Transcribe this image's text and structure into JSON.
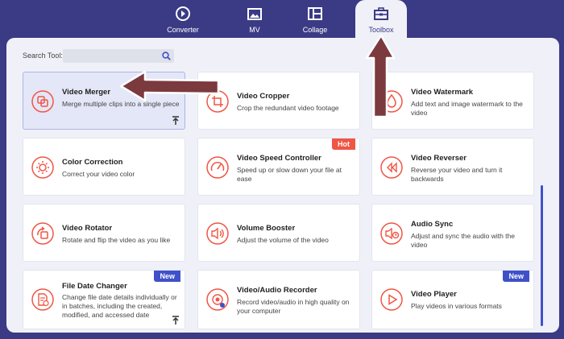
{
  "tabs": [
    {
      "id": "converter",
      "label": "Converter",
      "icon": "converter-icon",
      "active": false
    },
    {
      "id": "mv",
      "label": "MV",
      "icon": "mv-icon",
      "active": false
    },
    {
      "id": "collage",
      "label": "Collage",
      "icon": "collage-icon",
      "active": false
    },
    {
      "id": "toolbox",
      "label": "Toolbox",
      "icon": "toolbox-icon",
      "active": true
    }
  ],
  "search": {
    "label": "Search Tool:",
    "value": "",
    "placeholder": ""
  },
  "colors": {
    "accent": "#f05545",
    "brand": "#3b3a85",
    "blue": "#3f51c8",
    "arrow": "#7b3a3e"
  },
  "tools": [
    {
      "title": "Video Merger",
      "desc": "Merge multiple clips into a single piece",
      "icon": "merge-icon",
      "selected": true,
      "pin": true
    },
    {
      "title": "Video Cropper",
      "desc": "Crop the redundant video footage",
      "icon": "crop-icon"
    },
    {
      "title": "Video Watermark",
      "desc": "Add text and image watermark to the video",
      "icon": "watermark-icon"
    },
    {
      "title": "Color Correction",
      "desc": "Correct your video color",
      "icon": "sun-icon"
    },
    {
      "title": "Video Speed Controller",
      "desc": "Speed up or slow down your file at ease",
      "icon": "speedometer-icon",
      "badge": "Hot"
    },
    {
      "title": "Video Reverser",
      "desc": "Reverse your video and turn it backwards",
      "icon": "rewind-icon"
    },
    {
      "title": "Video Rotator",
      "desc": "Rotate and flip the video as you like",
      "icon": "rotate-icon"
    },
    {
      "title": "Volume Booster",
      "desc": "Adjust the volume of the video",
      "icon": "speaker-icon"
    },
    {
      "title": "Audio Sync",
      "desc": "Adjust and sync the audio with the video",
      "icon": "audio-sync-icon"
    },
    {
      "title": "File Date Changer",
      "desc": "Change file date details individually or in batches, including the created, modified, and accessed date",
      "icon": "file-date-icon",
      "badge": "New",
      "pin": true
    },
    {
      "title": "Video/Audio Recorder",
      "desc": "Record video/audio in high quality on your computer",
      "icon": "recorder-icon"
    },
    {
      "title": "Video Player",
      "desc": "Play videos in various formats",
      "icon": "play-icon",
      "badge": "New"
    }
  ]
}
